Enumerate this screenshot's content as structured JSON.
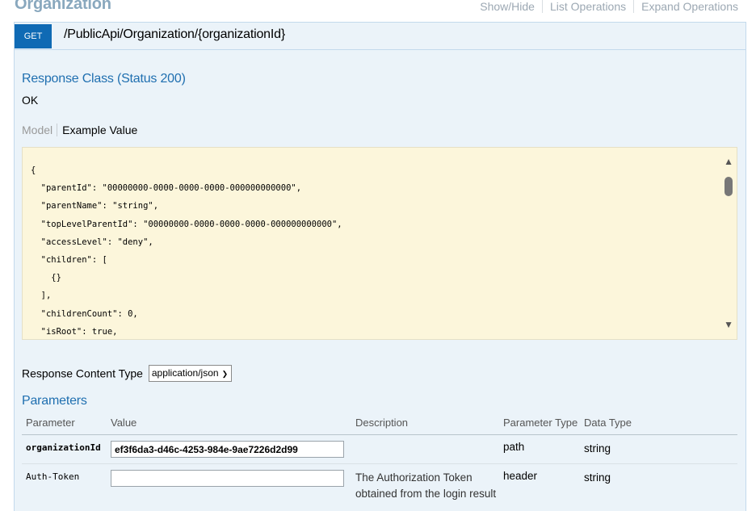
{
  "header": {
    "section_title": "Organization",
    "links": [
      "Show/Hide",
      "List Operations",
      "Expand Operations"
    ]
  },
  "operation": {
    "method": "GET",
    "path": "/PublicApi/Organization/{organizationId}"
  },
  "response_class": {
    "title": "Response Class (Status 200)",
    "text": "OK"
  },
  "model_tabs": {
    "model_label": "Model",
    "example_label": "Example Value"
  },
  "example_value": "{\n  \"parentId\": \"00000000-0000-0000-0000-000000000000\",\n  \"parentName\": \"string\",\n  \"topLevelParentId\": \"00000000-0000-0000-0000-000000000000\",\n  \"accessLevel\": \"deny\",\n  \"children\": [\n    {}\n  ],\n  \"childrenCount\": 0,\n  \"isRoot\": true,",
  "response_content_type": {
    "label": "Response Content Type",
    "selected": "application/json"
  },
  "parameters": {
    "title": "Parameters",
    "columns": {
      "parameter": "Parameter",
      "value": "Value",
      "description": "Description",
      "parameter_type": "Parameter Type",
      "data_type": "Data Type"
    },
    "rows": [
      {
        "name": "organizationId",
        "value": "ef3f6da3-d46c-4253-984e-9ae7226d2d99",
        "description": "",
        "parameter_type": "path",
        "data_type": "string"
      },
      {
        "name": "Auth-Token",
        "value": "",
        "description_line1": "The Authorization Token",
        "description_line2": "obtained from the login result",
        "parameter_type": "header",
        "data_type": "string"
      }
    ]
  }
}
